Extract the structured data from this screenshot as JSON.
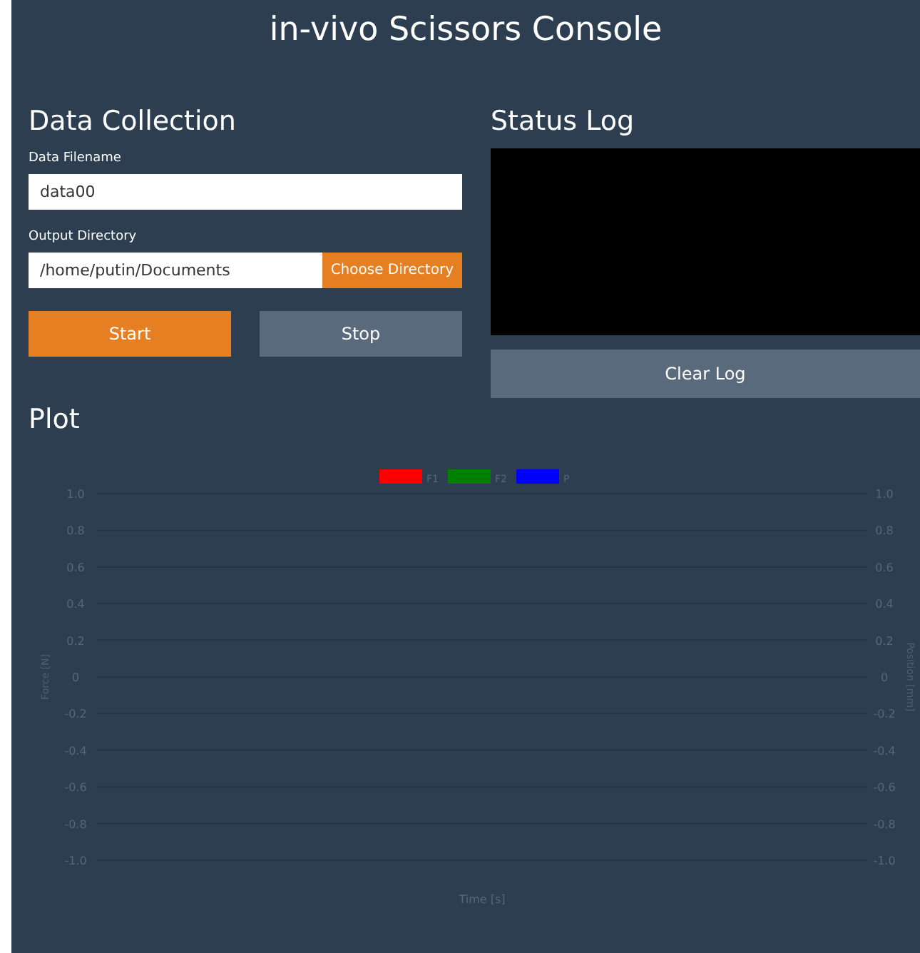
{
  "header": {
    "title": "in-vivo Scissors Console"
  },
  "data_collection": {
    "heading": "Data Collection",
    "filename": {
      "label": "Data Filename",
      "value": "data00"
    },
    "directory": {
      "label": "Output Directory",
      "value": "/home/putin/Documents",
      "button": "Choose Directory"
    },
    "buttons": [
      {
        "label": "Start",
        "kind": "primary"
      },
      {
        "label": "Stop",
        "kind": "secondary"
      }
    ]
  },
  "status_log": {
    "heading": "Status Log",
    "button": "Clear Log"
  },
  "plot": {
    "heading": "Plot",
    "chart_data": {
      "type": "line",
      "grid": true,
      "xlabel": "Time [s]",
      "ylabel": "Force [N]",
      "y2label": "Position [mm]",
      "ylim": [
        -1,
        1
      ],
      "yticks": [
        {
          "value": 1,
          "label": "1.0"
        },
        {
          "value": 0.8,
          "label": "0.8"
        },
        {
          "value": 0.6,
          "label": "0.6"
        },
        {
          "value": 0.4,
          "label": "0.4"
        },
        {
          "value": 0.2,
          "label": "0.2"
        },
        {
          "value": 0,
          "label": "0"
        },
        {
          "value": -0.2,
          "label": "-0.2"
        },
        {
          "value": -0.4,
          "label": "-0.4"
        },
        {
          "value": -0.6,
          "label": "-0.6"
        },
        {
          "value": -0.8,
          "label": "-0.8"
        },
        {
          "value": -1,
          "label": "-1.0"
        }
      ],
      "series": [
        {
          "name": "F1",
          "color": "#ff0000"
        },
        {
          "name": "F2",
          "color": "#008000"
        },
        {
          "name": "P",
          "color": "#0000ff"
        }
      ]
    }
  }
}
